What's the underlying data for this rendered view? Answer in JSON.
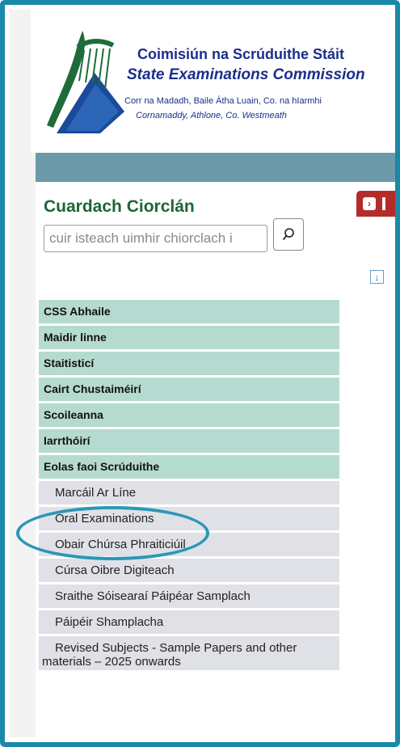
{
  "header": {
    "org_name_ga": "Coimisiún na Scrúduithe Stáit",
    "org_name_en": "State Examinations Commission",
    "address_ga": "Corr na Madadh, Baile Átha Luain, Co. na hIarmhi",
    "address_en": "Cornamaddy, Athlone, Co. Westmeath"
  },
  "search": {
    "heading": "Cuardach Ciorclán",
    "placeholder": "cuir isteach uimhir chiorclach i",
    "button_icon": "search-icon"
  },
  "menu": {
    "main_items": [
      {
        "label": "CSS Abhaile"
      },
      {
        "label": "Maidir linne"
      },
      {
        "label": "Staitisticí"
      },
      {
        "label": "Cairt Chustaiméirí"
      },
      {
        "label": "Scoileanna"
      },
      {
        "label": "Iarrthóirí"
      },
      {
        "label": "Eolas faoi Scrúduithe"
      }
    ],
    "sub_items": [
      {
        "label": "Marcáil Ar Líne"
      },
      {
        "label": "Oral Examinations"
      },
      {
        "label": "Obair Chúrsa Phraiticiúil"
      },
      {
        "label": "Cúrsa Oibre Digiteach"
      },
      {
        "label": "Sraithe Sóisearaí Páipéar Samplach"
      },
      {
        "label": "Páipéir Shamplacha"
      },
      {
        "label_line1": "Revised Subjects - Sample Papers and other",
        "label_line2": "materials – 2025 onwards"
      }
    ]
  },
  "colors": {
    "frame": "#1a88a8",
    "nav_bar": "#6d9aab",
    "menu_bg": "#b5dbd0",
    "submenu_bg": "#e0e1e6",
    "heading_green": "#1d6637",
    "brand_blue": "#1a2f8a",
    "red_tab": "#b52a2a"
  }
}
